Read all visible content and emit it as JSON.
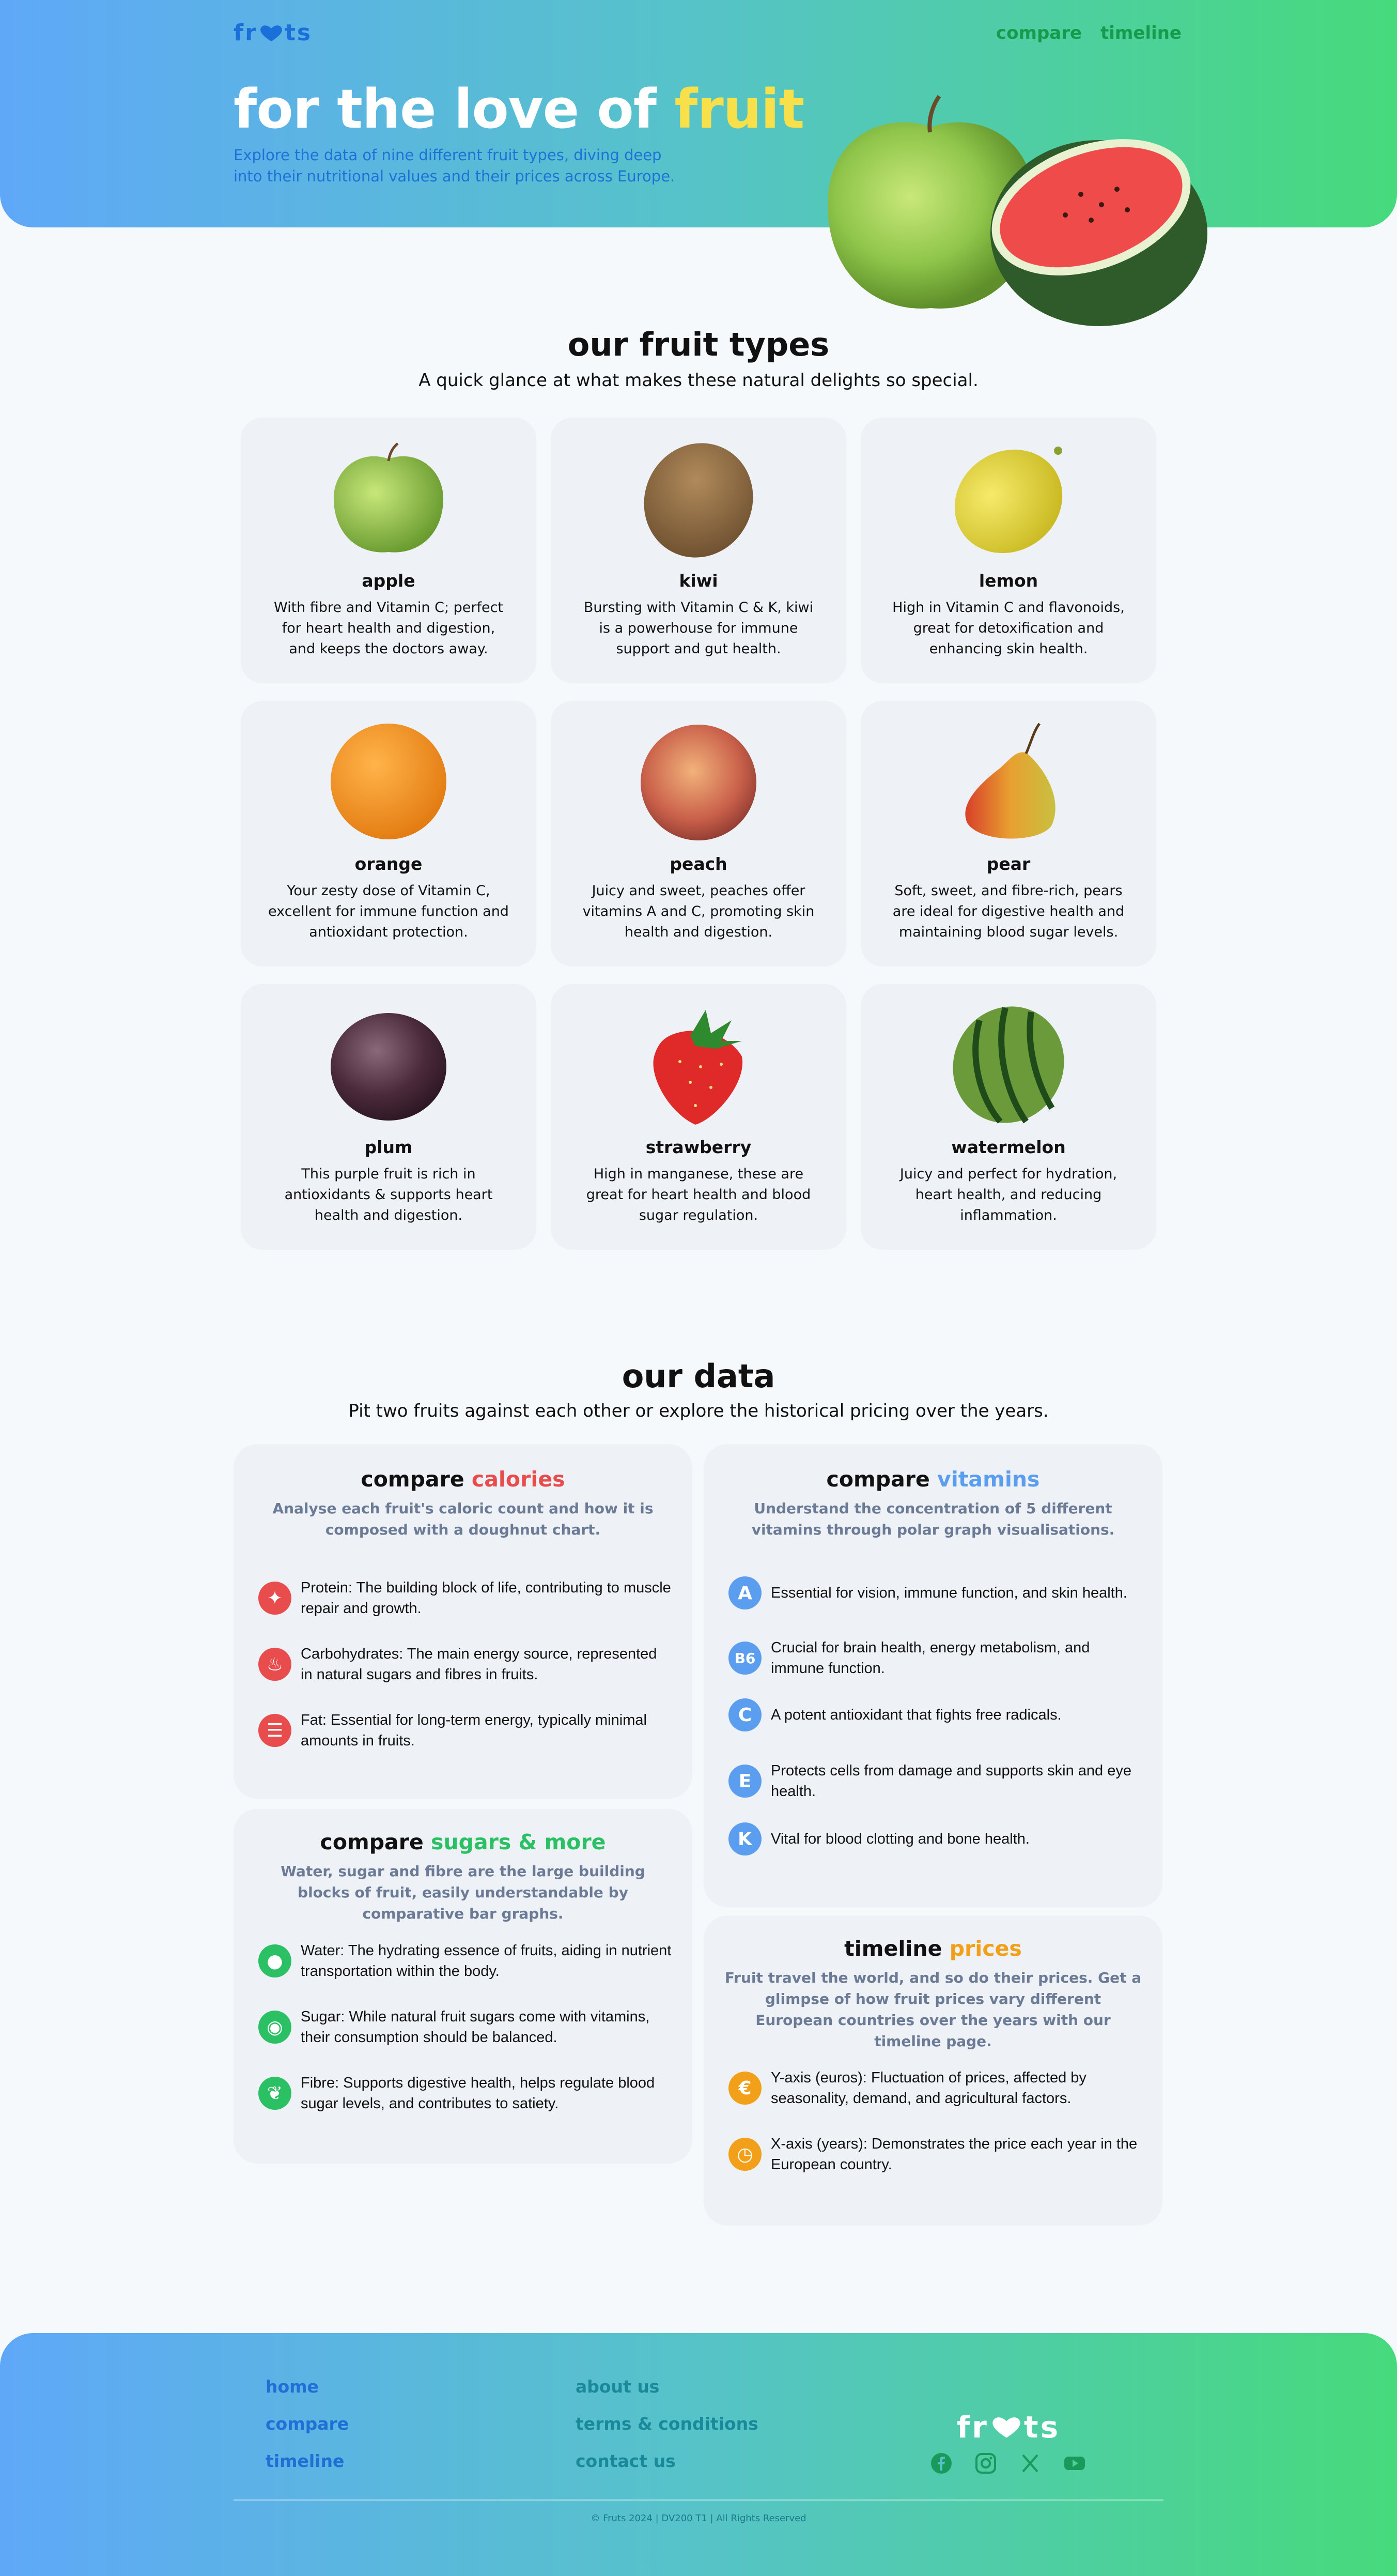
{
  "header": {
    "logo_left": "fr",
    "logo_right": "ts",
    "nav": {
      "compare": "compare",
      "timeline": "timeline"
    }
  },
  "hero": {
    "title_main": "for the love of ",
    "title_accent": "fruit",
    "subtitle": "Explore the data of nine different fruit types, diving deep into their nutritional values and their prices across Europe."
  },
  "fruit_types": {
    "heading": "our fruit types",
    "lead": "A quick glance at what makes these natural delights so special.",
    "cards": [
      {
        "name": "apple",
        "desc": "With fibre and Vitamin C; perfect for heart health and digestion, and keeps the doctors away."
      },
      {
        "name": "kiwi",
        "desc": "Bursting with Vitamin C & K, kiwi is a powerhouse for immune support and gut health."
      },
      {
        "name": "lemon",
        "desc": "High in Vitamin C and flavonoids, great for detoxification and enhancing skin health."
      },
      {
        "name": "orange",
        "desc": "Your zesty dose of Vitamin C, excellent for immune function and antioxidant protection."
      },
      {
        "name": "peach",
        "desc": "Juicy and sweet, peaches offer vitamins A and C, promoting skin health and digestion."
      },
      {
        "name": "pear",
        "desc": "Soft, sweet, and fibre-rich, pears are ideal for digestive health and maintaining blood sugar levels."
      },
      {
        "name": "plum",
        "desc": "This purple fruit is rich in antioxidants & supports heart health and digestion."
      },
      {
        "name": "strawberry",
        "desc": "High in manganese, these are great for heart health and blood sugar regulation."
      },
      {
        "name": "watermelon",
        "desc": "Juicy and perfect for hydration, heart health, and reducing inflammation."
      }
    ]
  },
  "our_data": {
    "heading": "our data",
    "lead": "Pit two fruits against each other or explore the historical pricing over the years.",
    "calories": {
      "title_a": "compare ",
      "title_b": "calories",
      "sub": "Analyse each fruit's caloric count and how it is composed with a doughnut chart.",
      "items": [
        {
          "icon": "protein-icon",
          "text": "Protein: The building block of life, contributing to muscle repair and growth."
        },
        {
          "icon": "carbohydrates-icon",
          "text": "Carbohydrates: The main energy source, represented in natural sugars and fibres in fruits."
        },
        {
          "icon": "fat-icon",
          "text": "Fat: Essential for long-term energy, typically minimal amounts in fruits."
        }
      ]
    },
    "vitamins": {
      "title_a": "compare ",
      "title_b": "vitamins",
      "sub": "Understand the concentration of 5 different vitamins through polar graph visualisations.",
      "items": [
        {
          "letter": "A",
          "text": "Essential for vision, immune function, and skin health."
        },
        {
          "letter": "B6",
          "text": "Crucial for brain health, energy metabolism, and immune function."
        },
        {
          "letter": "C",
          "text": "A potent antioxidant that fights free radicals."
        },
        {
          "letter": "E",
          "text": "Protects cells from damage and supports skin and eye health."
        },
        {
          "letter": "K",
          "text": "Vital for blood clotting and bone health."
        }
      ]
    },
    "sugars": {
      "title_a": "compare ",
      "title_b": "sugars & more",
      "sub": "Water, sugar and fibre are the large building blocks of fruit, easily understandable by comparative bar graphs.",
      "items": [
        {
          "icon": "water-drop-icon",
          "text": "Water: The hydrating essence of fruits, aiding in nutrient transportation within the body."
        },
        {
          "icon": "sugar-icon",
          "text": "Sugar: While natural fruit sugars come with vitamins, their consumption should be balanced."
        },
        {
          "icon": "fibre-leaf-icon",
          "text": "Fibre: Supports digestive health, helps regulate blood sugar levels, and contributes to satiety."
        }
      ]
    },
    "timeline": {
      "title_a": "timeline ",
      "title_b": "prices",
      "sub": "Fruit travel the world, and so do their prices. Get a glimpse of how fruit prices vary different European countries over the years with our timeline page.",
      "items": [
        {
          "icon": "euro-icon",
          "text": "Y-axis (euros): Fluctuation of prices, affected by seasonality, demand, and agricultural factors."
        },
        {
          "icon": "clock-icon",
          "text": "X-axis (years): Demonstrates the price each year in the European country."
        }
      ]
    }
  },
  "footer": {
    "links_a": [
      "home",
      "compare",
      "timeline"
    ],
    "links_b": [
      "about us",
      "terms & conditions",
      "contact us"
    ],
    "logo_left": "fr",
    "logo_right": "ts",
    "social": [
      "facebook-icon",
      "instagram-icon",
      "x-icon",
      "youtube-icon"
    ],
    "copyright": "© Fruts 2024 | DV200 T1 | All Rights Reserved"
  },
  "colors": {
    "calories": "#e94c4c",
    "vitamins": "#5b9ef0",
    "sugars": "#2cc065",
    "prices": "#f2a01a",
    "accent_yellow": "#f8e04a"
  }
}
